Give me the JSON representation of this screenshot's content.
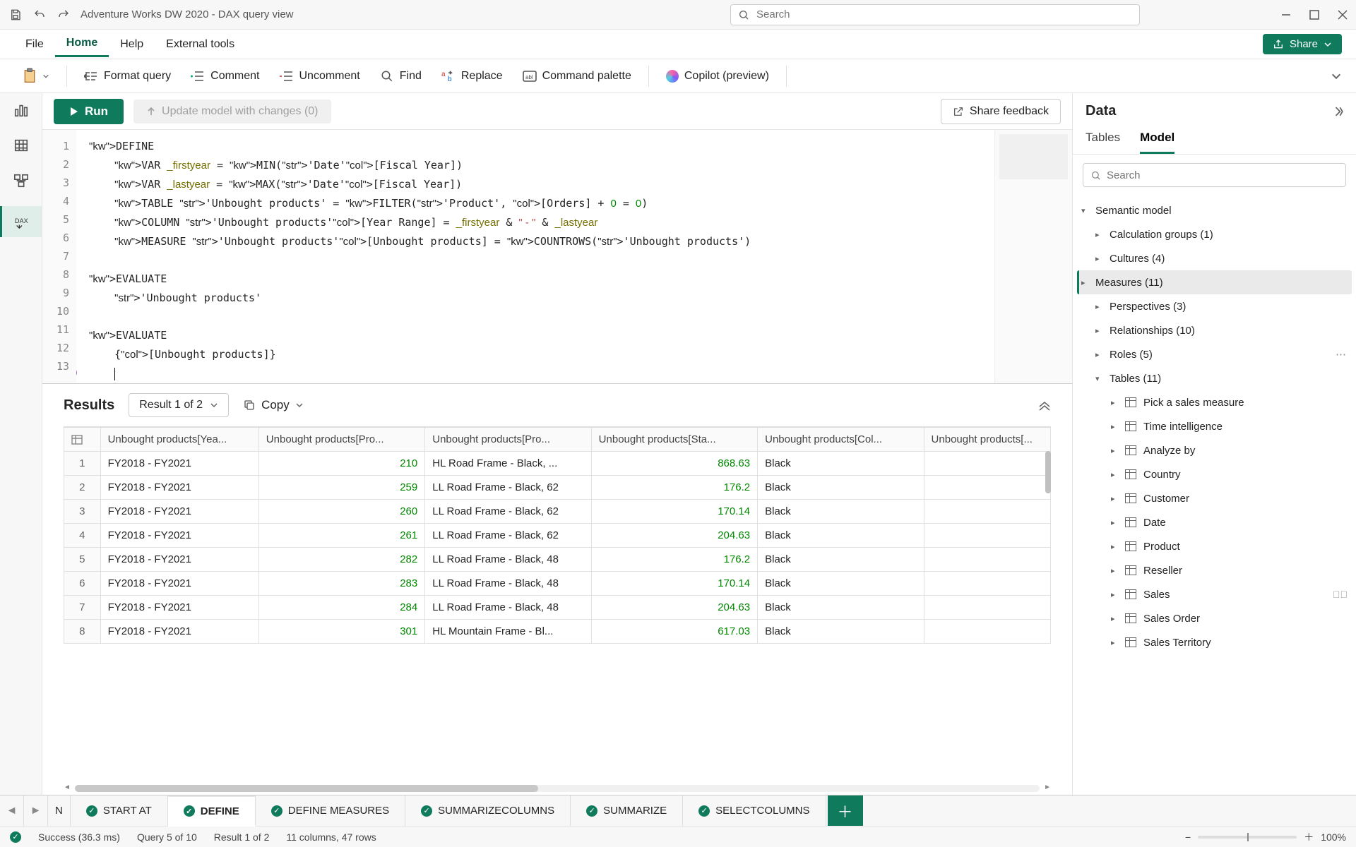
{
  "title_bar": {
    "title": "Adventure Works DW 2020 - DAX query view",
    "search_placeholder": "Search"
  },
  "menu": {
    "items": [
      "File",
      "Home",
      "Help",
      "External tools"
    ],
    "share": "Share"
  },
  "toolbar": {
    "paste": "",
    "format_query": "Format query",
    "comment": "Comment",
    "uncomment": "Uncomment",
    "find": "Find",
    "replace": "Replace",
    "command_palette": "Command palette",
    "copilot": "Copilot (preview)"
  },
  "run_bar": {
    "run": "Run",
    "update": "Update model with changes (0)",
    "feedback": "Share feedback"
  },
  "code_lines": [
    "DEFINE",
    "    VAR _firstyear = MIN('Date'[Fiscal Year])",
    "    VAR _lastyear = MAX('Date'[Fiscal Year])",
    "    TABLE 'Unbought products' = FILTER('Product', [Orders] + 0 = 0)",
    "    COLUMN 'Unbought products'[Year Range] = _firstyear & \" - \" & _lastyear",
    "    MEASURE 'Unbought products'[Unbought products] = COUNTROWS('Unbought products')",
    "",
    "EVALUATE",
    "    'Unbought products'",
    "",
    "EVALUATE",
    "    {[Unbought products]}",
    ""
  ],
  "results": {
    "title": "Results",
    "selector": "Result 1 of 2",
    "copy": "Copy",
    "columns": [
      "Unbought products[Yea...",
      "Unbought products[Pro...",
      "Unbought products[Pro...",
      "Unbought products[Sta...",
      "Unbought products[Col...",
      "Unbought products[..."
    ],
    "rows": [
      {
        "n": 1,
        "year": "FY2018 - FY2021",
        "id": 210,
        "name": "HL Road Frame - Black, ...",
        "cost": 868.63,
        "color": "Black"
      },
      {
        "n": 2,
        "year": "FY2018 - FY2021",
        "id": 259,
        "name": "LL Road Frame - Black, 62",
        "cost": 176.2,
        "color": "Black"
      },
      {
        "n": 3,
        "year": "FY2018 - FY2021",
        "id": 260,
        "name": "LL Road Frame - Black, 62",
        "cost": 170.14,
        "color": "Black"
      },
      {
        "n": 4,
        "year": "FY2018 - FY2021",
        "id": 261,
        "name": "LL Road Frame - Black, 62",
        "cost": 204.63,
        "color": "Black"
      },
      {
        "n": 5,
        "year": "FY2018 - FY2021",
        "id": 282,
        "name": "LL Road Frame - Black, 48",
        "cost": 176.2,
        "color": "Black"
      },
      {
        "n": 6,
        "year": "FY2018 - FY2021",
        "id": 283,
        "name": "LL Road Frame - Black, 48",
        "cost": 170.14,
        "color": "Black"
      },
      {
        "n": 7,
        "year": "FY2018 - FY2021",
        "id": 284,
        "name": "LL Road Frame - Black, 48",
        "cost": 204.63,
        "color": "Black"
      },
      {
        "n": 8,
        "year": "FY2018 - FY2021",
        "id": 301,
        "name": "HL Mountain Frame - Bl...",
        "cost": 617.03,
        "color": "Black"
      }
    ]
  },
  "data_panel": {
    "title": "Data",
    "tabs": [
      "Tables",
      "Model"
    ],
    "search_placeholder": "Search",
    "root": "Semantic model",
    "nodes": [
      {
        "label": "Calculation groups (1)"
      },
      {
        "label": "Cultures (4)"
      },
      {
        "label": "Measures (11)",
        "selected": true
      },
      {
        "label": "Perspectives (3)"
      },
      {
        "label": "Relationships (10)"
      },
      {
        "label": "Roles (5)",
        "more": true
      }
    ],
    "tables_header": "Tables (11)",
    "tables": [
      {
        "label": "Pick a sales measure"
      },
      {
        "label": "Time intelligence"
      },
      {
        "label": "Analyze by"
      },
      {
        "label": "Country"
      },
      {
        "label": "Customer"
      },
      {
        "label": "Date"
      },
      {
        "label": "Product"
      },
      {
        "label": "Reseller"
      },
      {
        "label": "Sales",
        "hidden": true
      },
      {
        "label": "Sales Order"
      },
      {
        "label": "Sales Territory"
      }
    ]
  },
  "query_tabs": {
    "truncated": "N",
    "tabs": [
      "START AT",
      "DEFINE",
      "DEFINE MEASURES",
      "SUMMARIZECOLUMNS",
      "SUMMARIZE",
      "SELECTCOLUMNS"
    ],
    "active": "DEFINE"
  },
  "status": {
    "success": "Success (36.3 ms)",
    "query": "Query 5 of 10",
    "result": "Result 1 of 2",
    "shape": "11 columns, 47 rows",
    "zoom": "100%"
  }
}
